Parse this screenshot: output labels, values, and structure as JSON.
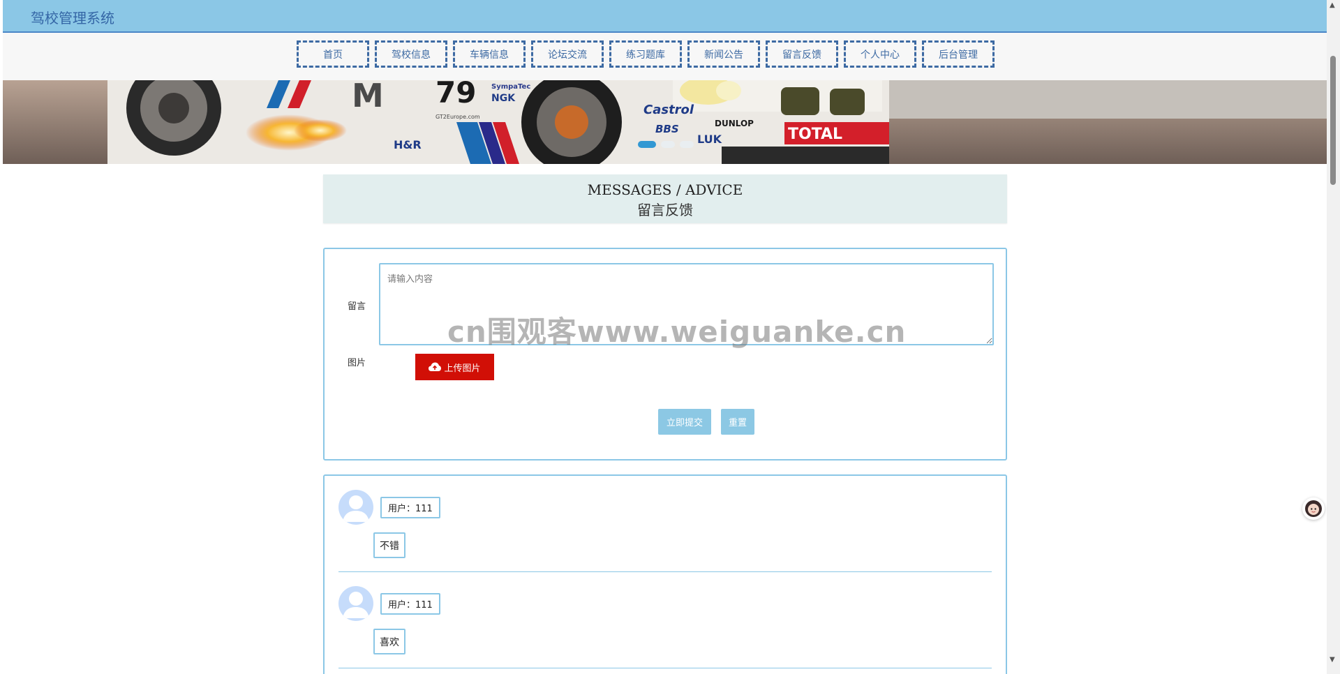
{
  "header": {
    "title": "驾校管理系统",
    "bg_color": "#8bc7e6",
    "title_color": "#3466a6"
  },
  "nav": {
    "items": [
      {
        "label": "首页"
      },
      {
        "label": "驾校信息"
      },
      {
        "label": "车辆信息"
      },
      {
        "label": "论坛交流"
      },
      {
        "label": "练习题库"
      },
      {
        "label": "新闻公告"
      },
      {
        "label": "留言反馈"
      },
      {
        "label": "个人中心"
      },
      {
        "label": "后台管理"
      }
    ]
  },
  "banner": {
    "dots": 3,
    "active_dot": 1,
    "decals": {
      "number": "79",
      "m": "M",
      "castrol": "Castrol",
      "dunlop": "DUNLOP",
      "total": "TOTAL",
      "bbs": "BBS",
      "luk": "LUK",
      "ngk": "NGK",
      "sympatec": "SympaTec",
      "hr": "H&R",
      "gt2": "GT2Europe.com"
    }
  },
  "section": {
    "title_en": "MESSAGES / ADVICE",
    "title_cn": "留言反馈"
  },
  "form": {
    "message_label": "留言",
    "message_placeholder": "请输入内容",
    "image_label": "图片",
    "upload_label": "上传图片",
    "submit_label": "立即提交",
    "reset_label": "重置"
  },
  "watermark": "cn围观客www.weiguanke.cn",
  "messages": [
    {
      "user": "用户：111",
      "content": "不错"
    },
    {
      "user": "用户：111",
      "content": "喜欢"
    }
  ],
  "colors": {
    "accent": "#8bc7e6",
    "danger": "#d10f06",
    "nav_border": "#3d6aa3"
  }
}
